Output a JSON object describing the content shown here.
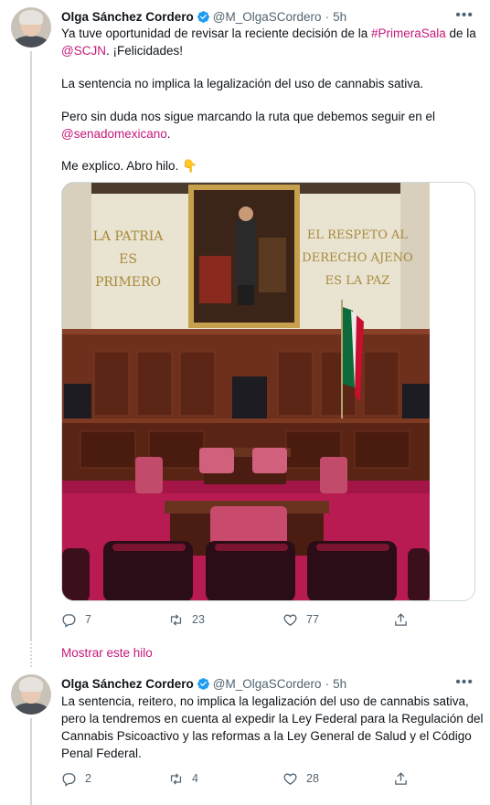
{
  "tweet1": {
    "author_name": "Olga Sánchez Cordero",
    "handle": "@M_OlgaSCordero",
    "separator": "·",
    "time": "5h",
    "para1": {
      "t1": "Ya tuve oportunidad de revisar la reciente decisión de la ",
      "hashtag": "#PrimeraSala",
      "t2": " de la",
      "mention": "@SCJN",
      "t3": ". ¡Felicidades!"
    },
    "para2": "La sentencia no implica la legalización del uso de cannabis sativa.",
    "para3": {
      "t1": "Pero sin duda nos sigue marcando la ruta que debemos seguir en el",
      "mention": "@senadomexicano",
      "t2": "."
    },
    "para4": {
      "t1": "Me explico. Abro hilo. ",
      "emoji": "👇"
    },
    "image": {
      "wall_left": [
        "LA PATRIA",
        "ES",
        "PRIMERO"
      ],
      "wall_right": [
        "EL RESPETO AL",
        "DERECHO AJENO",
        "ES LA PAZ"
      ]
    },
    "reply_count": "7",
    "retweet_count": "23",
    "like_count": "77"
  },
  "show_thread": "Mostrar este hilo",
  "tweet2": {
    "author_name": "Olga Sánchez Cordero",
    "handle": "@M_OlgaSCordero",
    "separator": "·",
    "time": "5h",
    "line1": "La sentencia, reitero, no implica la legalización del uso de cannabis sativa,",
    "line2": "pero la tendremos en cuenta al expedir la Ley Federal para la Regulación del",
    "line3": "Cannabis Psicoactivo y las reformas a la Ley General de Salud y el Código",
    "line4": "Penal Federal.",
    "reply_count": "2",
    "retweet_count": "4",
    "like_count": "28"
  },
  "icons": {
    "verified": "verified-badge-icon",
    "more": "more-options-icon",
    "reply": "reply-icon",
    "retweet": "retweet-icon",
    "like": "like-icon",
    "share": "share-icon"
  },
  "colors": {
    "accent": "#c4197a",
    "verified": "#1d9bf0",
    "secondary_text": "#536471",
    "thread_line": "#cfd9de"
  }
}
